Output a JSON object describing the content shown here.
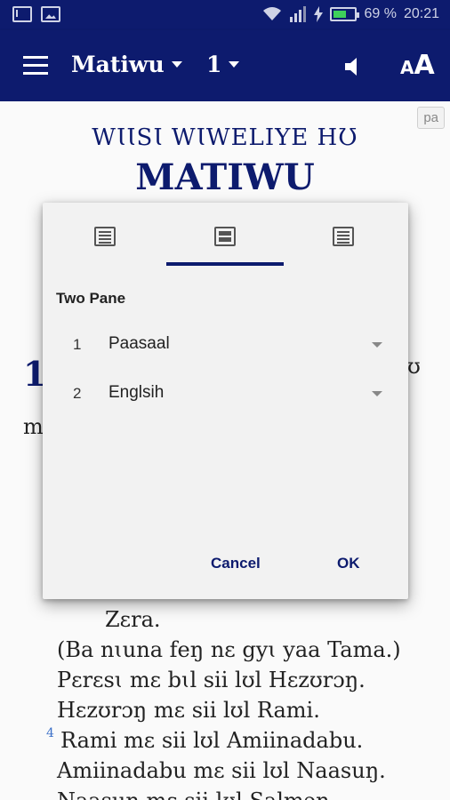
{
  "status_bar": {
    "battery_percent": "69 %",
    "time": "20:21",
    "icons": [
      "mail-icon",
      "image-icon",
      "wifi-icon",
      "signal-icon",
      "charging-icon",
      "battery-icon"
    ]
  },
  "app_bar": {
    "book": "Matiwu",
    "chapter": "1",
    "icons": [
      "menu-icon",
      "speaker-icon",
      "font-size-icon"
    ],
    "font_size_small": "A",
    "font_size_big": "A"
  },
  "content": {
    "lang_badge": "pa",
    "book_subtitle": "WƖƖSƖ WƖWELIYE HƱ",
    "book_title": "MATIWU",
    "chapter_number": "1",
    "peek_right": "ʊ",
    "peek_left": "m",
    "verse_lines": [
      {
        "text": "Zɛra.",
        "indent": true
      },
      {
        "text": "(Ba nɩuna feŋ nɛ gyɩ yaa Tama.)",
        "indent": false
      },
      {
        "text": "Pɛrɛsɩ mɛ bɩl sii lʊl Hɛzʊrɔŋ.",
        "indent": false
      },
      {
        "text": "Hɛzʊrɔŋ mɛ sii lʊl Rami.",
        "indent": false
      },
      {
        "text": "Rami mɛ sii lʊl Amiinadabu.",
        "indent": false,
        "verse": "4"
      },
      {
        "text": "Amiinadabu mɛ sii lʊl Naasuŋ.",
        "indent": false
      },
      {
        "text": "Naasuŋ mɛ sii lʊl Salmɔn",
        "indent": false
      }
    ]
  },
  "dialog": {
    "tabs": [
      "single-pane-tab",
      "two-pane-tab",
      "interlinear-tab"
    ],
    "active_tab": "two-pane-tab",
    "section_label": "Two Pane",
    "panes": [
      {
        "number": "1",
        "value": "Paasaal"
      },
      {
        "number": "2",
        "value": "Englsih"
      }
    ],
    "cancel_label": "Cancel",
    "ok_label": "OK"
  },
  "colors": {
    "primary": "#0d1b6e",
    "accent": "#0d1b6e",
    "verse_number": "#3a6fc8"
  }
}
